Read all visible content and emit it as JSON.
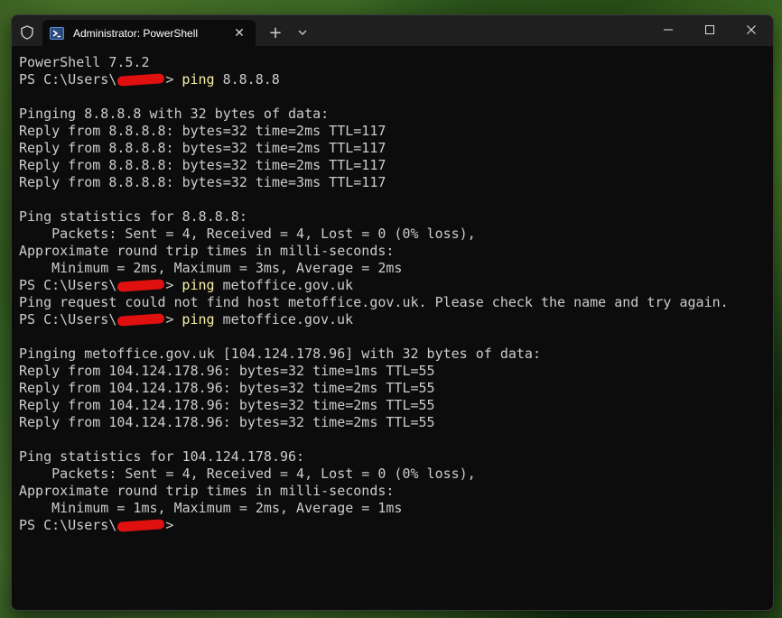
{
  "window": {
    "tab_title": "Administrator: PowerShell",
    "new_tab_label": "+",
    "close_tab_label": "✕"
  },
  "icons": {
    "shield": "shield-icon",
    "tab": "powershell-icon",
    "dropdown": "chevron-down-icon",
    "minimize": "minimize-icon",
    "maximize": "maximize-icon",
    "close": "close-icon"
  },
  "colors": {
    "terminal_bg": "#0c0c0c",
    "text": "#cccccc",
    "command": "#f9f1a5",
    "titlebar": "#1f1f1f"
  },
  "terminal": {
    "version": "PowerShell 7.5.2",
    "prompt_prefix": "PS C:\\Users\\",
    "prompt_suffix": ">",
    "cmd1": " ping",
    "cmd1_arg": " 8.8.8.8",
    "ping1_header": "Pinging 8.8.8.8 with 32 bytes of data:",
    "ping1_replies": [
      "Reply from 8.8.8.8: bytes=32 time=2ms TTL=117",
      "Reply from 8.8.8.8: bytes=32 time=2ms TTL=117",
      "Reply from 8.8.8.8: bytes=32 time=2ms TTL=117",
      "Reply from 8.8.8.8: bytes=32 time=3ms TTL=117"
    ],
    "ping1_stats_header": "Ping statistics for 8.8.8.8:",
    "ping1_packets": "    Packets: Sent = 4, Received = 4, Lost = 0 (0% loss),",
    "rtt_header": "Approximate round trip times in milli-seconds:",
    "ping1_rtt": "    Minimum = 2ms, Maximum = 3ms, Average = 2ms",
    "cmd2": " ping",
    "cmd2_arg": " metoffice.gov.uk",
    "error": "Ping request could not find host metoffice.gov.uk. Please check the name and try again.",
    "cmd3": " ping",
    "cmd3_arg": " metoffice.gov.uk",
    "ping2_header": "Pinging metoffice.gov.uk [104.124.178.96] with 32 bytes of data:",
    "ping2_replies": [
      "Reply from 104.124.178.96: bytes=32 time=1ms TTL=55",
      "Reply from 104.124.178.96: bytes=32 time=2ms TTL=55",
      "Reply from 104.124.178.96: bytes=32 time=2ms TTL=55",
      "Reply from 104.124.178.96: bytes=32 time=2ms TTL=55"
    ],
    "ping2_stats_header": "Ping statistics for 104.124.178.96:",
    "ping2_packets": "    Packets: Sent = 4, Received = 4, Lost = 0 (0% loss),",
    "ping2_rtt": "    Minimum = 1ms, Maximum = 2ms, Average = 1ms"
  }
}
